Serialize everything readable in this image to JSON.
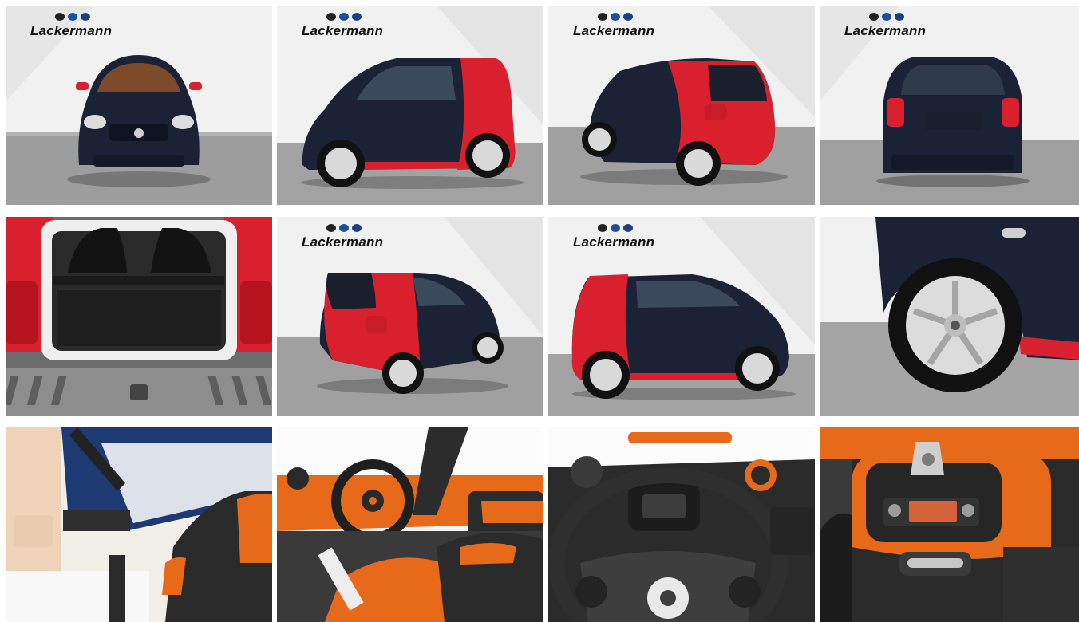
{
  "gallery": {
    "dealer_logo_text": "Lackermann",
    "tiles": [
      {
        "id": "front",
        "has_logo": true
      },
      {
        "id": "side-left",
        "has_logo": true
      },
      {
        "id": "rear-three-quarter",
        "has_logo": true
      },
      {
        "id": "rear",
        "has_logo": true
      },
      {
        "id": "trunk",
        "has_logo": false
      },
      {
        "id": "rear-left-three-quarter",
        "has_logo": true
      },
      {
        "id": "side-right",
        "has_logo": true
      },
      {
        "id": "wheel",
        "has_logo": false
      },
      {
        "id": "panorama-roof",
        "has_logo": false
      },
      {
        "id": "cockpit",
        "has_logo": false
      },
      {
        "id": "steering-wheel",
        "has_logo": false
      },
      {
        "id": "center-console",
        "has_logo": false
      }
    ]
  },
  "colors": {
    "body_dark": "#1c2236",
    "body_red": "#d8202e",
    "interior_orange": "#e66a1a",
    "floor_grey": "#9a9a9a",
    "wall": "#f2f2f2"
  }
}
